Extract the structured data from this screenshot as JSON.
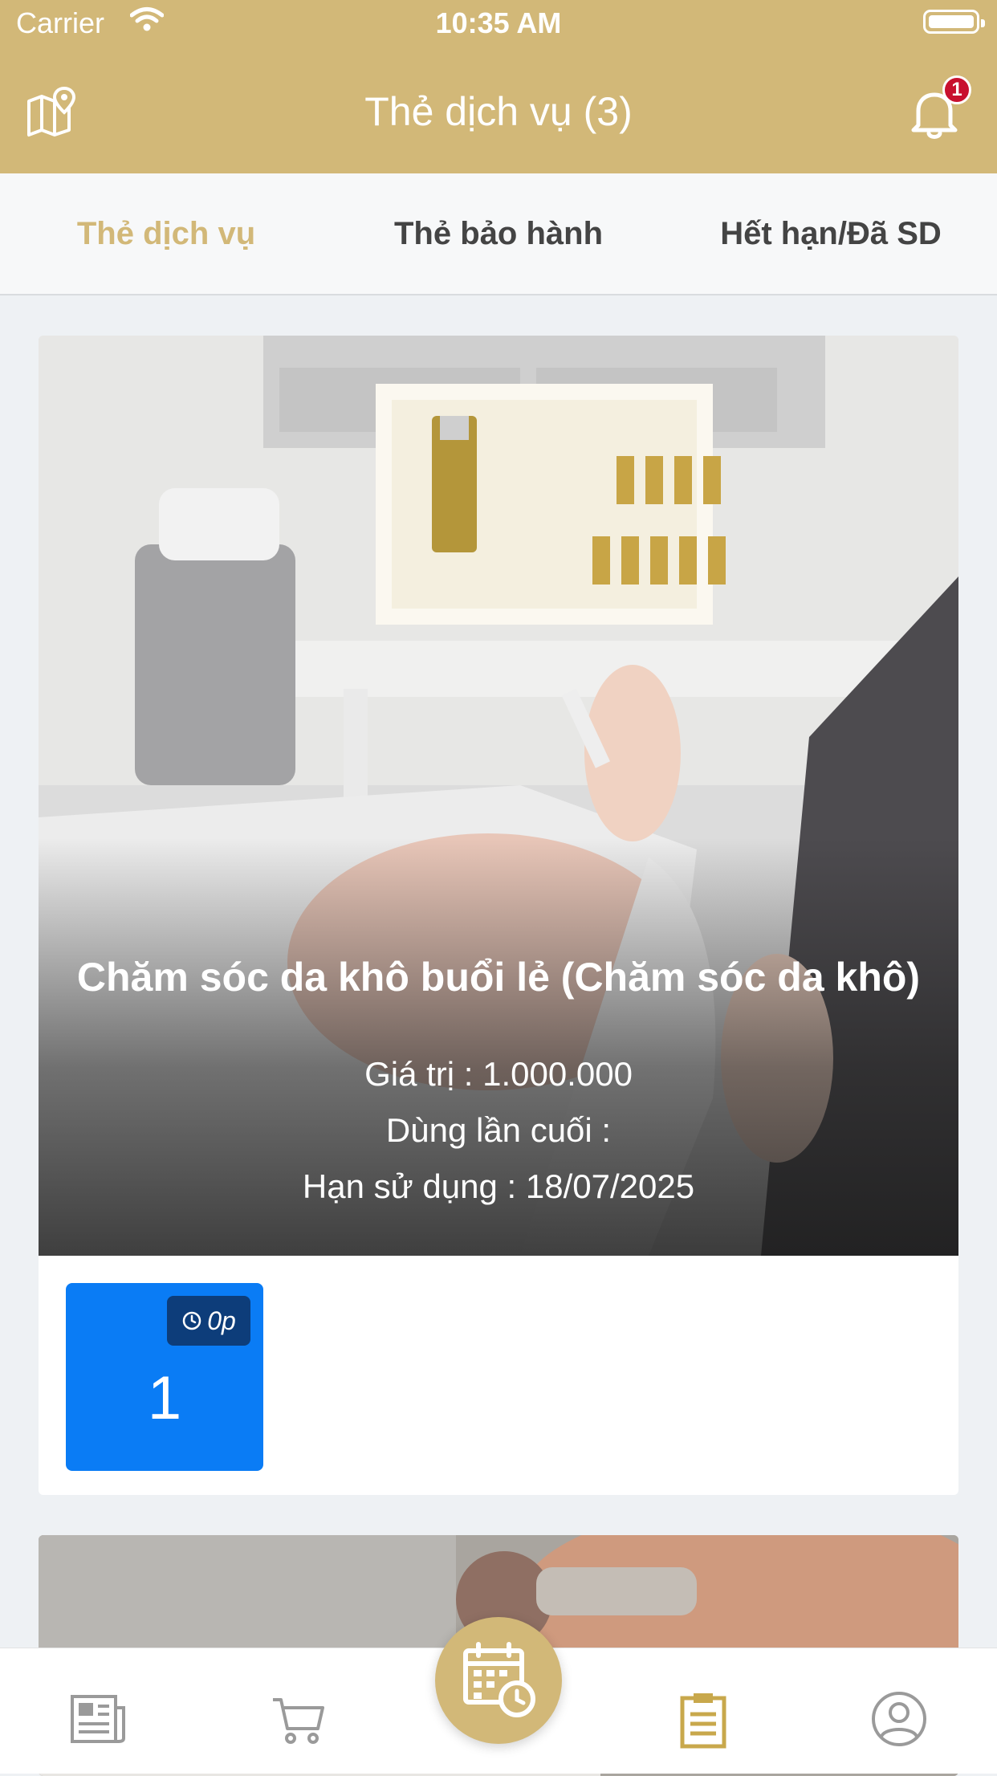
{
  "status_bar": {
    "carrier": "Carrier",
    "time": "10:35 AM"
  },
  "header": {
    "title": "Thẻ dịch vụ (3)",
    "notification_count": "1"
  },
  "tabs": [
    {
      "label": "Thẻ dịch vụ",
      "active": true
    },
    {
      "label": "Thẻ bảo hành",
      "active": false
    },
    {
      "label": "Hết hạn/Đã SD",
      "active": false
    }
  ],
  "cards": [
    {
      "name": "Chăm sóc da khô buổi lẻ (Chăm sóc da khô)",
      "value_line": "Giá trị : 1.000.000",
      "last_used_line": "Dùng lần cuối :",
      "expiry_line": "Hạn sử dụng : 18/07/2025",
      "session_duration": "0p",
      "session_count": "1"
    }
  ],
  "bottom_nav": {
    "items": [
      "news-icon",
      "cart-icon",
      "calendar-clock-icon",
      "clipboard-icon",
      "profile-icon"
    ]
  },
  "colors": {
    "brand": "#d2b878",
    "session_tile": "#0a7cf5",
    "badge": "#c8102e"
  }
}
